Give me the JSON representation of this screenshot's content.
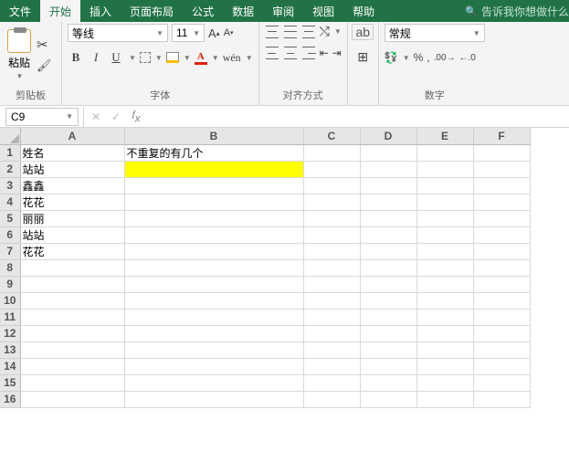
{
  "tabs": {
    "items": [
      "文件",
      "开始",
      "插入",
      "页面布局",
      "公式",
      "数据",
      "审阅",
      "视图",
      "帮助"
    ],
    "active": 1,
    "tell": "告诉我你想做什么"
  },
  "ribbon": {
    "clipboard": {
      "paste": "粘贴",
      "title": "剪贴板"
    },
    "font": {
      "name": "等线",
      "size": "11",
      "grow": "A",
      "shrink": "A",
      "bold": "B",
      "italic": "I",
      "underline": "U",
      "pinyin": "wén",
      "title": "字体"
    },
    "align": {
      "wrap_label": "ab",
      "title": "对齐方式"
    },
    "number": {
      "format": "常规",
      "title": "数字"
    }
  },
  "formula": {
    "namebox": "C9",
    "value": ""
  },
  "grid": {
    "cols": [
      "A",
      "B",
      "C",
      "D",
      "E",
      "F"
    ],
    "rows": 16,
    "cells": {
      "A1": "姓名",
      "B1": "不重复的有几个",
      "A2": "站站",
      "A3": "鑫鑫",
      "A4": "花花",
      "A5": "丽丽",
      "A6": "站站",
      "A7": "花花"
    },
    "highlight": "B2"
  }
}
